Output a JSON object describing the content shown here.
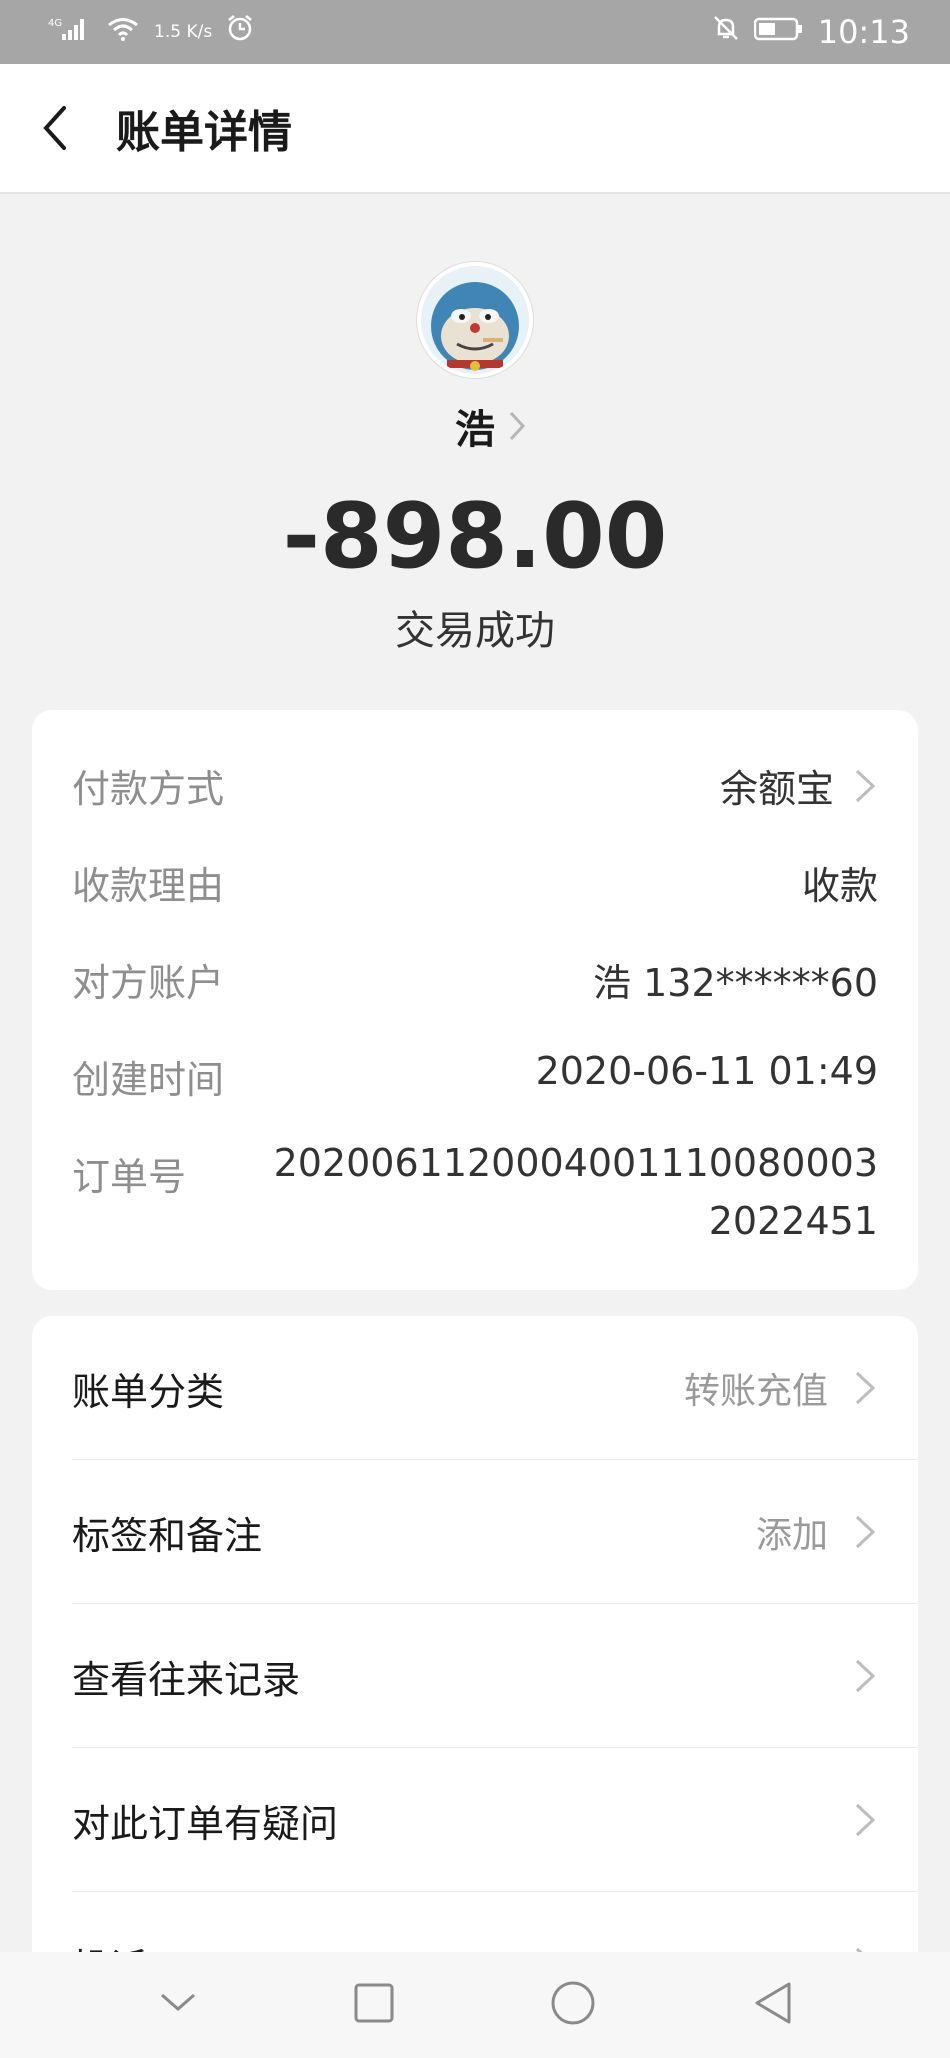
{
  "status_bar": {
    "network": "4G",
    "speed": "1.5 K/s",
    "time": "10:13"
  },
  "header": {
    "title": "账单详情"
  },
  "payee": {
    "name": "浩",
    "amount": "-898.00",
    "status": "交易成功"
  },
  "details": [
    {
      "label": "付款方式",
      "value": "余额宝",
      "has_arrow": true
    },
    {
      "label": "收款理由",
      "value": "收款"
    },
    {
      "label": "对方账户",
      "value": "浩 132******60"
    },
    {
      "label": "创建时间",
      "value": "2020-06-11 01:49"
    },
    {
      "label": "订单号",
      "value": "20200611200040011100800032022451"
    }
  ],
  "menu": [
    {
      "label": "账单分类",
      "value": "转账充值"
    },
    {
      "label": "标签和备注",
      "value": "添加"
    },
    {
      "label": "查看往来记录",
      "value": ""
    },
    {
      "label": "对此订单有疑问",
      "value": ""
    },
    {
      "label": "投诉",
      "value": ""
    }
  ],
  "colors": {
    "status_bar": "#a6a6a6",
    "background": "#f2f2f2",
    "card": "#ffffff",
    "label_gray": "#8e8e8e"
  }
}
